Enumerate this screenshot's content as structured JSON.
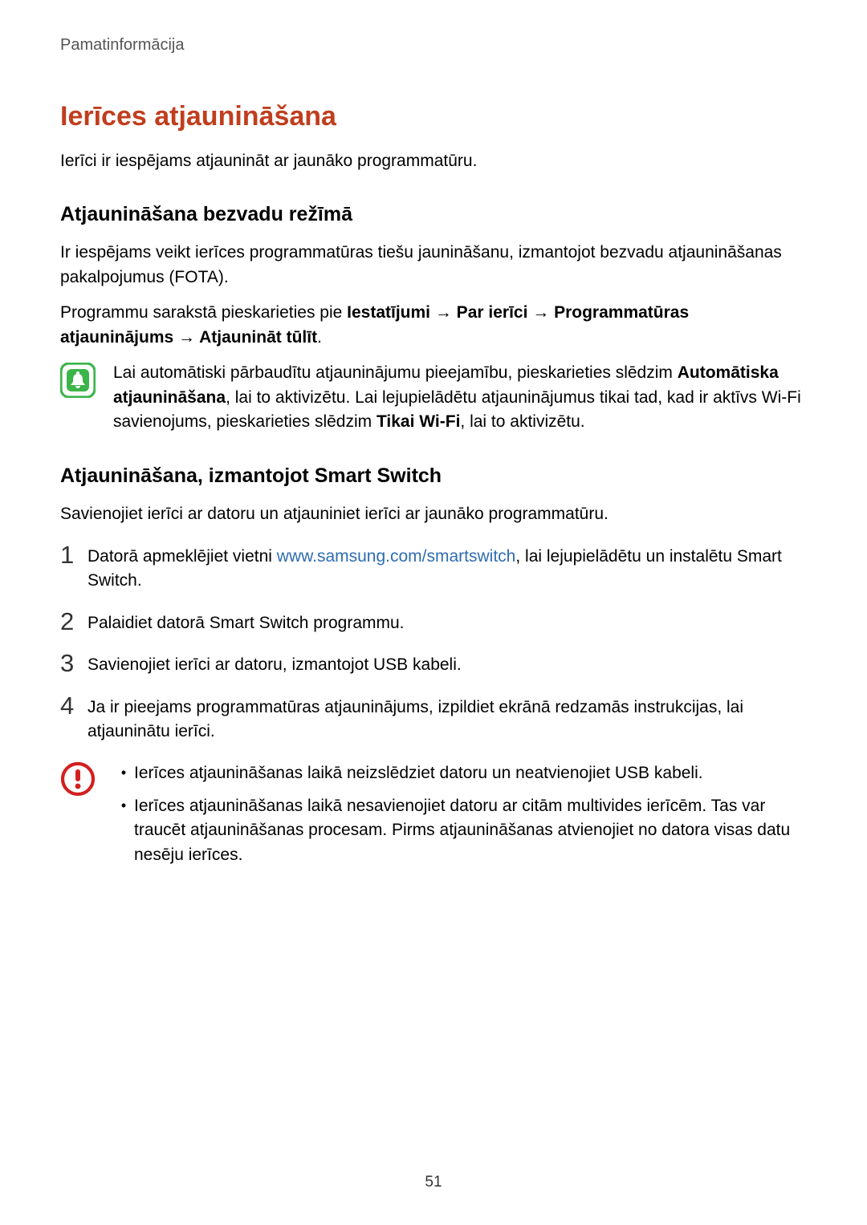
{
  "header": "Pamatinformācija",
  "pageNumber": "51",
  "title": "Ierīces atjaunināšana",
  "intro": "Ierīci ir iespējams atjaunināt ar jaunāko programmatūru.",
  "section1": {
    "title": "Atjaunināšana bezvadu režīmā",
    "p1": "Ir iespējams veikt ierīces programmatūras tiešu jaunināšanu, izmantojot bezvadu atjaunināšanas pakalpojumus (FOTA).",
    "p2a": "Programmu sarakstā pieskarieties pie ",
    "p2b": "Iestatījumi → Par ierīci → Programmatūras atjauninājums → Atjaunināt tūlīt",
    "p2c": ".",
    "callout_a": "Lai automātiski pārbaudītu atjauninājumu pieejamību, pieskarieties slēdzim ",
    "callout_b": "Automātiska atjaunināšana",
    "callout_c": ", lai to aktivizētu. Lai lejupielādētu atjauninājumus tikai tad, kad ir aktīvs Wi-Fi savienojums, pieskarieties slēdzim ",
    "callout_d": "Tikai Wi-Fi",
    "callout_e": ", lai to aktivizētu."
  },
  "section2": {
    "title": "Atjaunināšana, izmantojot Smart Switch",
    "p1": "Savienojiet ierīci ar datoru un atjauniniet ierīci ar jaunāko programmatūru.",
    "steps": {
      "n1": "1",
      "s1a": "Datorā apmeklējiet vietni ",
      "s1link": "www.samsung.com/smartswitch",
      "s1b": ", lai lejupielādētu un instalētu Smart Switch.",
      "n2": "2",
      "s2": "Palaidiet datorā Smart Switch programmu.",
      "n3": "3",
      "s3": "Savienojiet ierīci ar datoru, izmantojot USB kabeli.",
      "n4": "4",
      "s4": "Ja ir pieejams programmatūras atjauninājums, izpildiet ekrānā redzamās instrukcijas, lai atjauninātu ierīci."
    },
    "warn": {
      "b1": "Ierīces atjaunināšanas laikā neizslēdziet datoru un neatvienojiet USB kabeli.",
      "b2": "Ierīces atjaunināšanas laikā nesavienojiet datoru ar citām multivides ierīcēm. Tas var traucēt atjaunināšanas procesam. Pirms atjaunināšanas atvienojiet no datora visas datu nesēju ierīces."
    }
  }
}
